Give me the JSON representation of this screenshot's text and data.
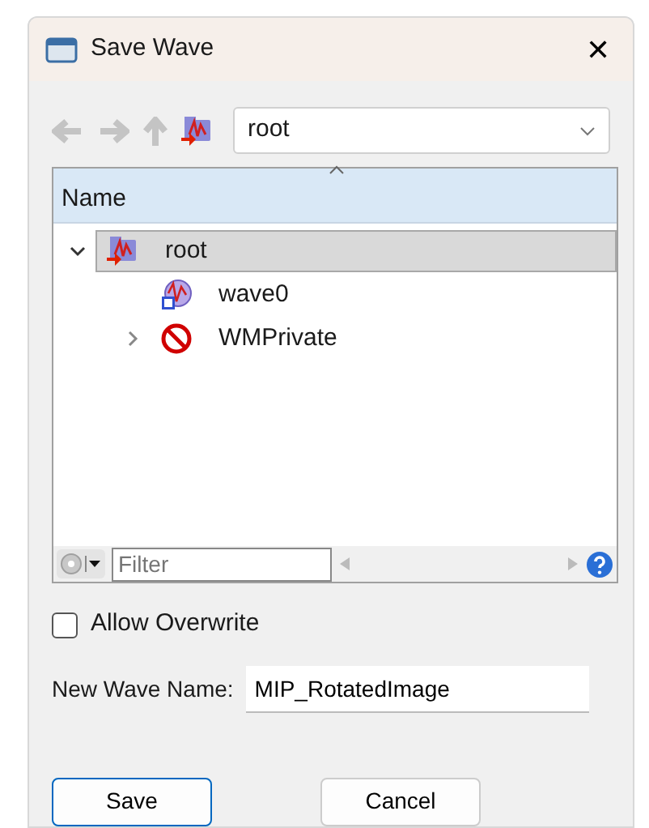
{
  "window": {
    "title": "Save Wave",
    "close": "✕"
  },
  "location": {
    "value": "root"
  },
  "tree": {
    "column": "Name",
    "items": [
      {
        "label": "root",
        "kind": "folder",
        "expanded": true,
        "selected": true,
        "children": [
          {
            "label": "wave0",
            "kind": "wave",
            "selected": false
          },
          {
            "label": "WMPrivate",
            "kind": "private",
            "expanded": false,
            "selected": false
          }
        ]
      }
    ]
  },
  "filter": {
    "placeholder": "Filter"
  },
  "allow_overwrite": {
    "label": "Allow Overwrite",
    "checked": false
  },
  "new_name": {
    "label": "New Wave Name:",
    "value": "MIP_RotatedImage"
  },
  "buttons": [
    {
      "label": "Save",
      "default": true
    },
    {
      "label": "Cancel",
      "default": false
    }
  ]
}
